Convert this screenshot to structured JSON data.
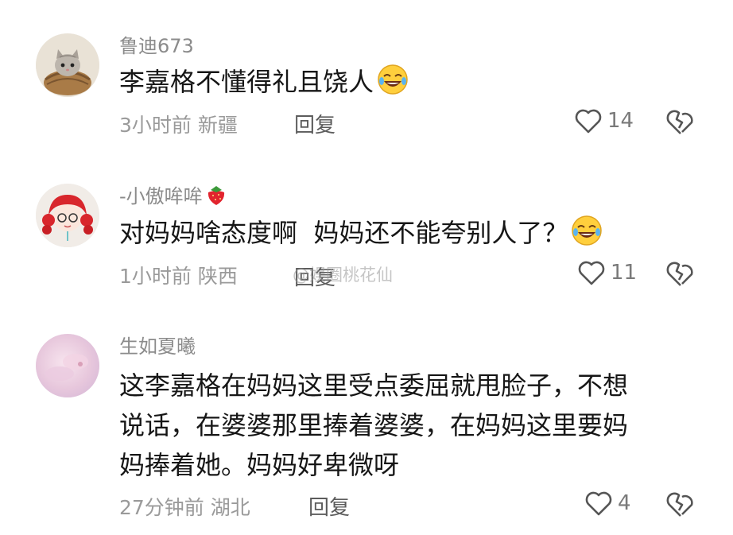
{
  "comments": [
    {
      "username": "鲁迪673",
      "text": "李嘉格不懂得礼且饶人",
      "meta": "3小时前 新疆",
      "reply_label": "回复",
      "like_count": "14",
      "avatar_icon": "kitten-in-basket-avatar",
      "trailing_emoji": "laughing-tears-emoji"
    },
    {
      "username": "-小傲哞哞",
      "username_emoji": "strawberry-emoji",
      "text": "对妈妈啥态度啊  妈妈还不能夸别人了？",
      "meta": "1小时前 陕西",
      "reply_label": "回复",
      "like_count": "11",
      "avatar_icon": "red-haired-girl-avatar",
      "trailing_emoji": "laughing-tears-emoji"
    },
    {
      "username": "生如夏曦",
      "text_lines": [
        "这李嘉格在妈妈这里受点委屈就甩脸子，不想",
        "说话，在婆婆那里捧着婆婆，在妈妈这里要妈",
        "妈捧着她。妈妈好卑微呀"
      ],
      "meta": "27分钟前 湖北",
      "reply_label": "回复",
      "like_count": "4",
      "avatar_icon": "pink-flower-avatar"
    }
  ],
  "watermark": "@娱圈桃花仙",
  "colors": {
    "username": "#8b8b8b",
    "text": "#161616",
    "meta": "#9a9a9a",
    "icon": "#555555"
  }
}
